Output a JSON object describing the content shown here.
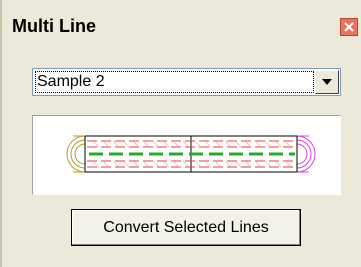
{
  "window": {
    "title": "Multi Line",
    "close_icon": "close-icon"
  },
  "style_select": {
    "selected": "Sample 2",
    "arrow_icon": "chevron-down-icon"
  },
  "preview": {
    "description_icon": "multiline-preview",
    "colors": {
      "left_cap": "#b89a2a",
      "right_cap": "#e040e0",
      "dashes": "#e04040",
      "center": "#20b020",
      "border": "#000000"
    }
  },
  "actions": {
    "convert_label": "Convert Selected Lines"
  },
  "colors": {
    "panel_bg": "#ece9d8",
    "close_bg": "#e8755e"
  }
}
